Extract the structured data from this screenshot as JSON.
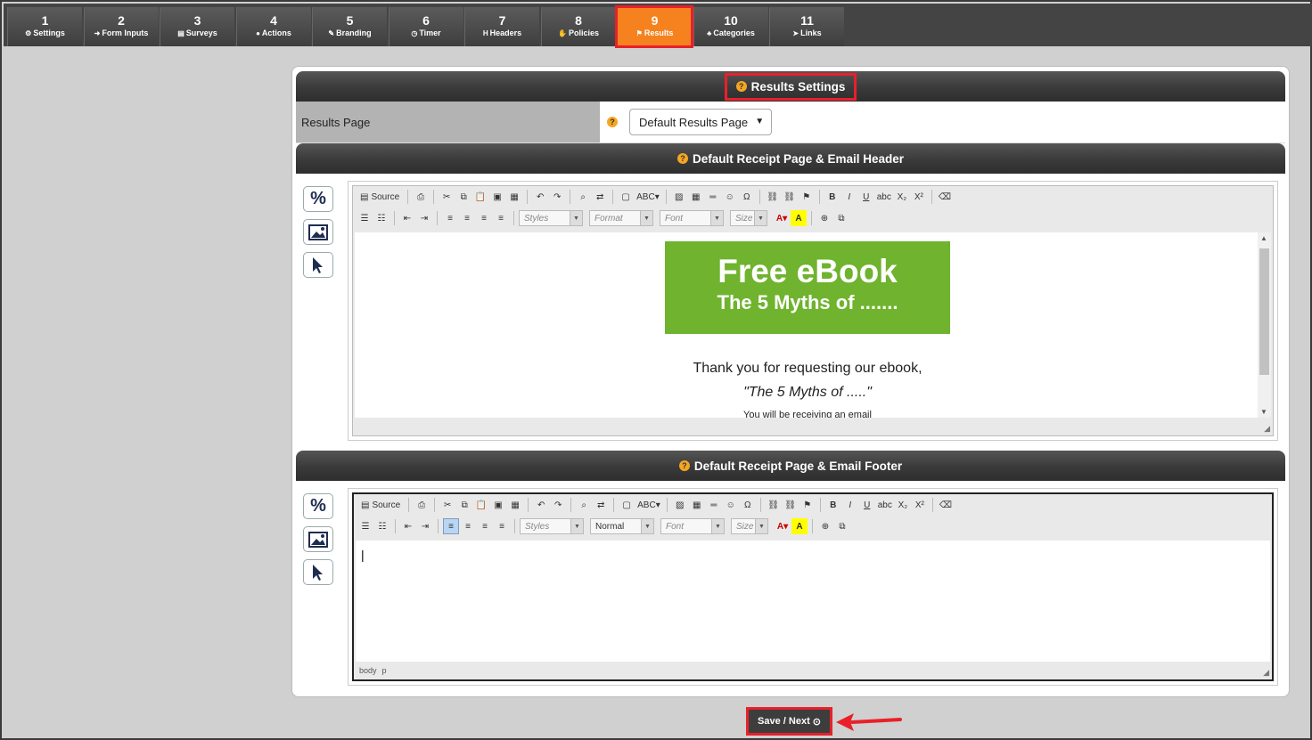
{
  "steps": [
    {
      "num": "1",
      "label": "Settings",
      "icon": "⚙"
    },
    {
      "num": "2",
      "label": "Form Inputs",
      "icon": "➜"
    },
    {
      "num": "3",
      "label": "Surveys",
      "icon": "▤"
    },
    {
      "num": "4",
      "label": "Actions",
      "icon": "●"
    },
    {
      "num": "5",
      "label": "Branding",
      "icon": "✎"
    },
    {
      "num": "6",
      "label": "Timer",
      "icon": "◷"
    },
    {
      "num": "7",
      "label": "Headers",
      "icon": "H"
    },
    {
      "num": "8",
      "label": "Policies",
      "icon": "✋"
    },
    {
      "num": "9",
      "label": "Results",
      "icon": "⚑"
    },
    {
      "num": "10",
      "label": "Categories",
      "icon": "♣"
    },
    {
      "num": "11",
      "label": "Links",
      "icon": "➤"
    }
  ],
  "active_step": "9",
  "results_settings": {
    "title": "Results Settings",
    "results_page_label": "Results Page",
    "results_page_value": "Default Results Page"
  },
  "header_section": {
    "title": "Default Receipt Page & Email Header",
    "banner_line1": "Free eBook",
    "banner_line2": "The 5 Myths of .......",
    "thanks_line": "Thank you for requesting our ebook,",
    "quote_line": "\"The 5 Myths of .....\"",
    "partial_line": "You will be receiving an email"
  },
  "footer_section": {
    "title": "Default Receipt Page & Email Footer",
    "status_path": [
      "body",
      "p"
    ]
  },
  "toolbar": {
    "source_label": "Source",
    "styles_placeholder": "Styles",
    "format_placeholder": "Format",
    "format_value_footer": "Normal",
    "font_placeholder": "Font",
    "size_placeholder": "Size"
  },
  "save_label": "Save / Next",
  "colors": {
    "accent": "#f5821f",
    "highlight": "#e8202a",
    "banner_green": "#6fb32e"
  }
}
